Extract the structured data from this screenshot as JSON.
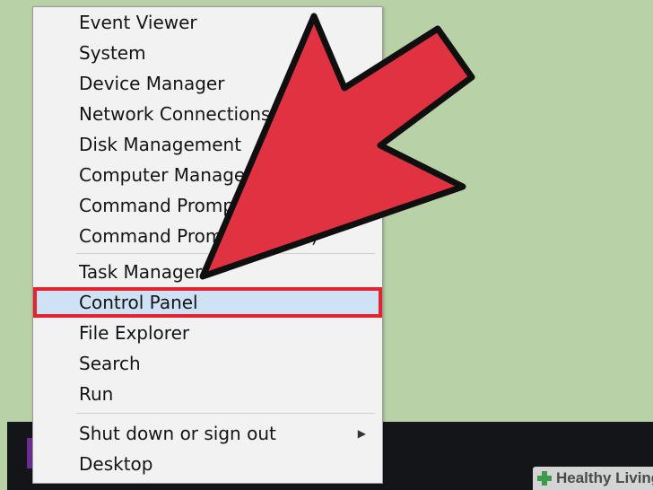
{
  "menu": {
    "items": [
      {
        "label": "Event Viewer"
      },
      {
        "label": "System"
      },
      {
        "label": "Device Manager"
      },
      {
        "label": "Network Connections"
      },
      {
        "label": "Disk Management"
      },
      {
        "label": "Computer Management"
      },
      {
        "label": "Command Prompt"
      },
      {
        "label": "Command Prompt (Admin)"
      },
      {
        "label": "Task Manager"
      },
      {
        "label": "Control Panel",
        "selected": true
      },
      {
        "label": "File Explorer"
      },
      {
        "label": "Search"
      },
      {
        "label": "Run"
      },
      {
        "label": "Shut down or sign out",
        "submenu_icon": "chevron-right-icon"
      },
      {
        "label": "Desktop"
      }
    ]
  },
  "watermark": {
    "text": "Healthy Living",
    "icon": "medical-cross-icon"
  },
  "colors": {
    "background": "#b9d1a6",
    "menu_bg": "#f2f2f2",
    "selected_bg": "#cfe1f4",
    "highlight_border": "#e3232d",
    "arrow": "#e03241",
    "taskbar": "#141518"
  }
}
